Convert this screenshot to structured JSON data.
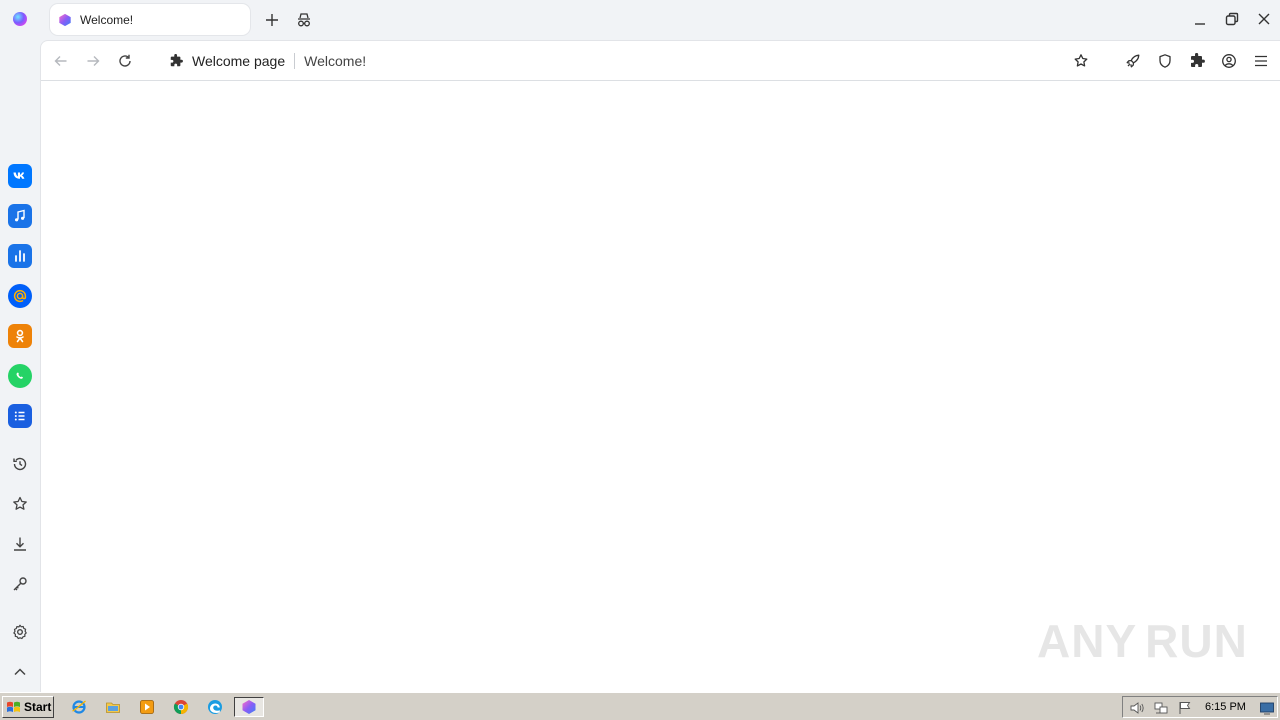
{
  "tab": {
    "title": "Welcome!"
  },
  "address_bar": {
    "site": "Welcome page",
    "page_title": "Welcome!"
  },
  "sidebar": {
    "apps": [
      {
        "name": "vk-icon",
        "color": "#0077ff"
      },
      {
        "name": "music-icon",
        "color": "#1a73e8"
      },
      {
        "name": "stats-icon",
        "color": "#1a73e8"
      },
      {
        "name": "mail-icon",
        "color": "#005ff9"
      },
      {
        "name": "odnoklassniki-icon",
        "color": "#ee8208"
      },
      {
        "name": "whatsapp-icon",
        "color": "#25d366"
      },
      {
        "name": "tasks-icon",
        "color": "#1a5fe0"
      }
    ],
    "tools": [
      "history-icon",
      "bookmarks-icon",
      "downloads-icon",
      "passwords-icon",
      "settings-icon",
      "collapse-icon"
    ]
  },
  "watermark": {
    "left": "ANY",
    "right": "RUN"
  },
  "taskbar": {
    "start_label": "Start",
    "apps": [
      "internet-explorer-icon",
      "file-explorer-icon",
      "media-player-icon",
      "chrome-icon",
      "edge-icon",
      "browser-icon"
    ],
    "clock": "6:15 PM"
  },
  "colors": {
    "accent": "#7a5cff",
    "chrome": "#f1f3f6",
    "taskbar": "#d4d0c8"
  }
}
